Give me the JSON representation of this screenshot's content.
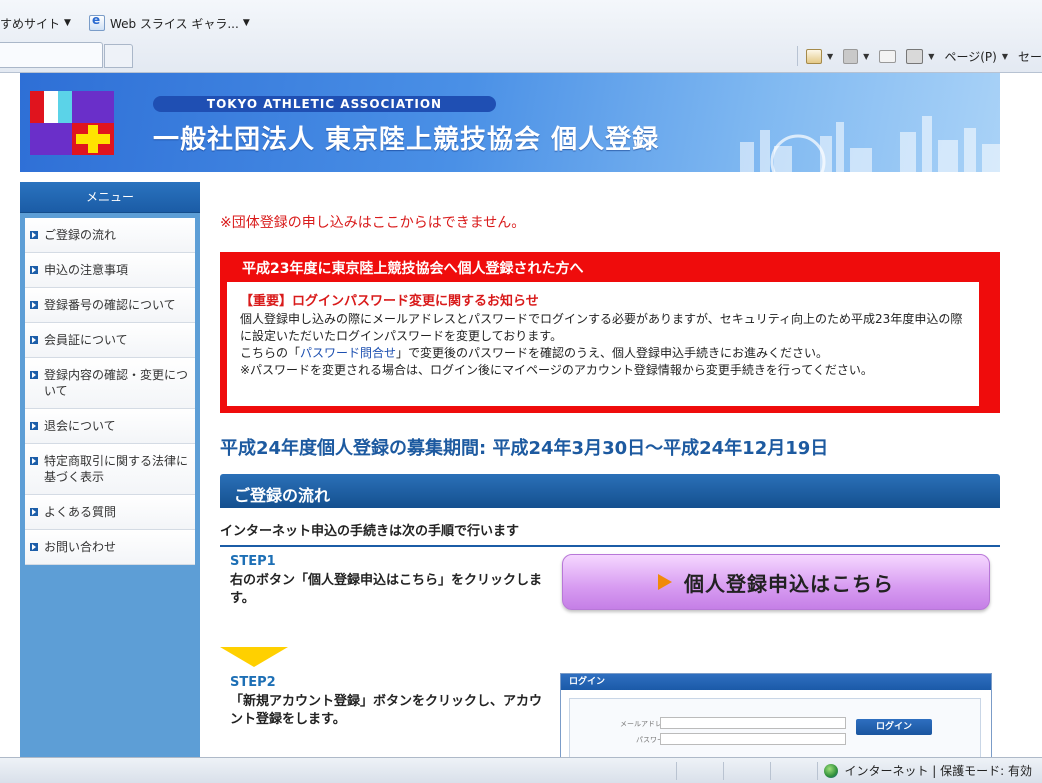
{
  "browser": {
    "favorites": [
      {
        "label": "すめサイト",
        "icon": "none"
      },
      {
        "label": "Web スライス ギャラ...",
        "icon": "ie-icon"
      }
    ],
    "commands": {
      "page_label": "ページ(P)",
      "safety_label": "セー"
    },
    "status": {
      "zone": "インターネット | 保護モード: 有効"
    }
  },
  "header": {
    "assoc_name": "TOKYO ATHLETIC ASSOCIATION",
    "title": "一般社団法人  東京陸上競技協会  個人登録",
    "logo_colors": [
      "#e0141e",
      "#ffffff",
      "#5bd3e8",
      "#6a2fc9",
      "#ffe300"
    ]
  },
  "sidebar": {
    "heading": "メニュー",
    "items": [
      {
        "label": "ご登録の流れ"
      },
      {
        "label": "申込の注意事項"
      },
      {
        "label": "登録番号の確認について"
      },
      {
        "label": "会員証について"
      },
      {
        "label": "登録内容の確認・変更について"
      },
      {
        "label": "退会について"
      },
      {
        "label": "特定商取引に関する法律に基づく表示"
      },
      {
        "label": "よくある質問"
      },
      {
        "label": "お問い合わせ"
      }
    ]
  },
  "main": {
    "notice": "※団体登録の申し込みはここからはできません。",
    "redbox": {
      "title": "平成23年度に東京陸上競技協会へ個人登録された方へ",
      "important": "【重要】ログインパスワード変更に関するお知らせ",
      "line1": "個人登録申し込みの際にメールアドレスとパスワードでログインする必要がありますが、セキュリティ向上のため平成23年度申込の際に設定いただいたログインパスワードを変更しております。",
      "line2_pre": "こちらの「",
      "line2_link": "パスワード問合せ",
      "line2_post": "」で変更後のパスワードを確認のうえ、個人登録申込手続きにお進みください。",
      "line3": "※パスワードを変更される場合は、ログイン後にマイページのアカウント登録情報から変更手続きを行ってください。"
    },
    "period": "平成24年度個人登録の募集期間: 平成24年3月30日〜平成24年12月19日",
    "flow_title": "ご登録の流れ",
    "flow_subtitle": "インターネット申込の手続きは次の手順で行います",
    "step1": {
      "label": "STEP1",
      "text": "右のボタン「個人登録申込はこちら」をクリックします。"
    },
    "cta_label": "個人登録申込はこちら",
    "step2": {
      "label": "STEP2",
      "text": "「新規アカウント登録」ボタンをクリックし、アカウント登録をします。"
    },
    "login_preview": {
      "header": "ログイン",
      "email_label": "メールアドレス",
      "password_label": "パスワード",
      "button": "ログイン"
    }
  }
}
